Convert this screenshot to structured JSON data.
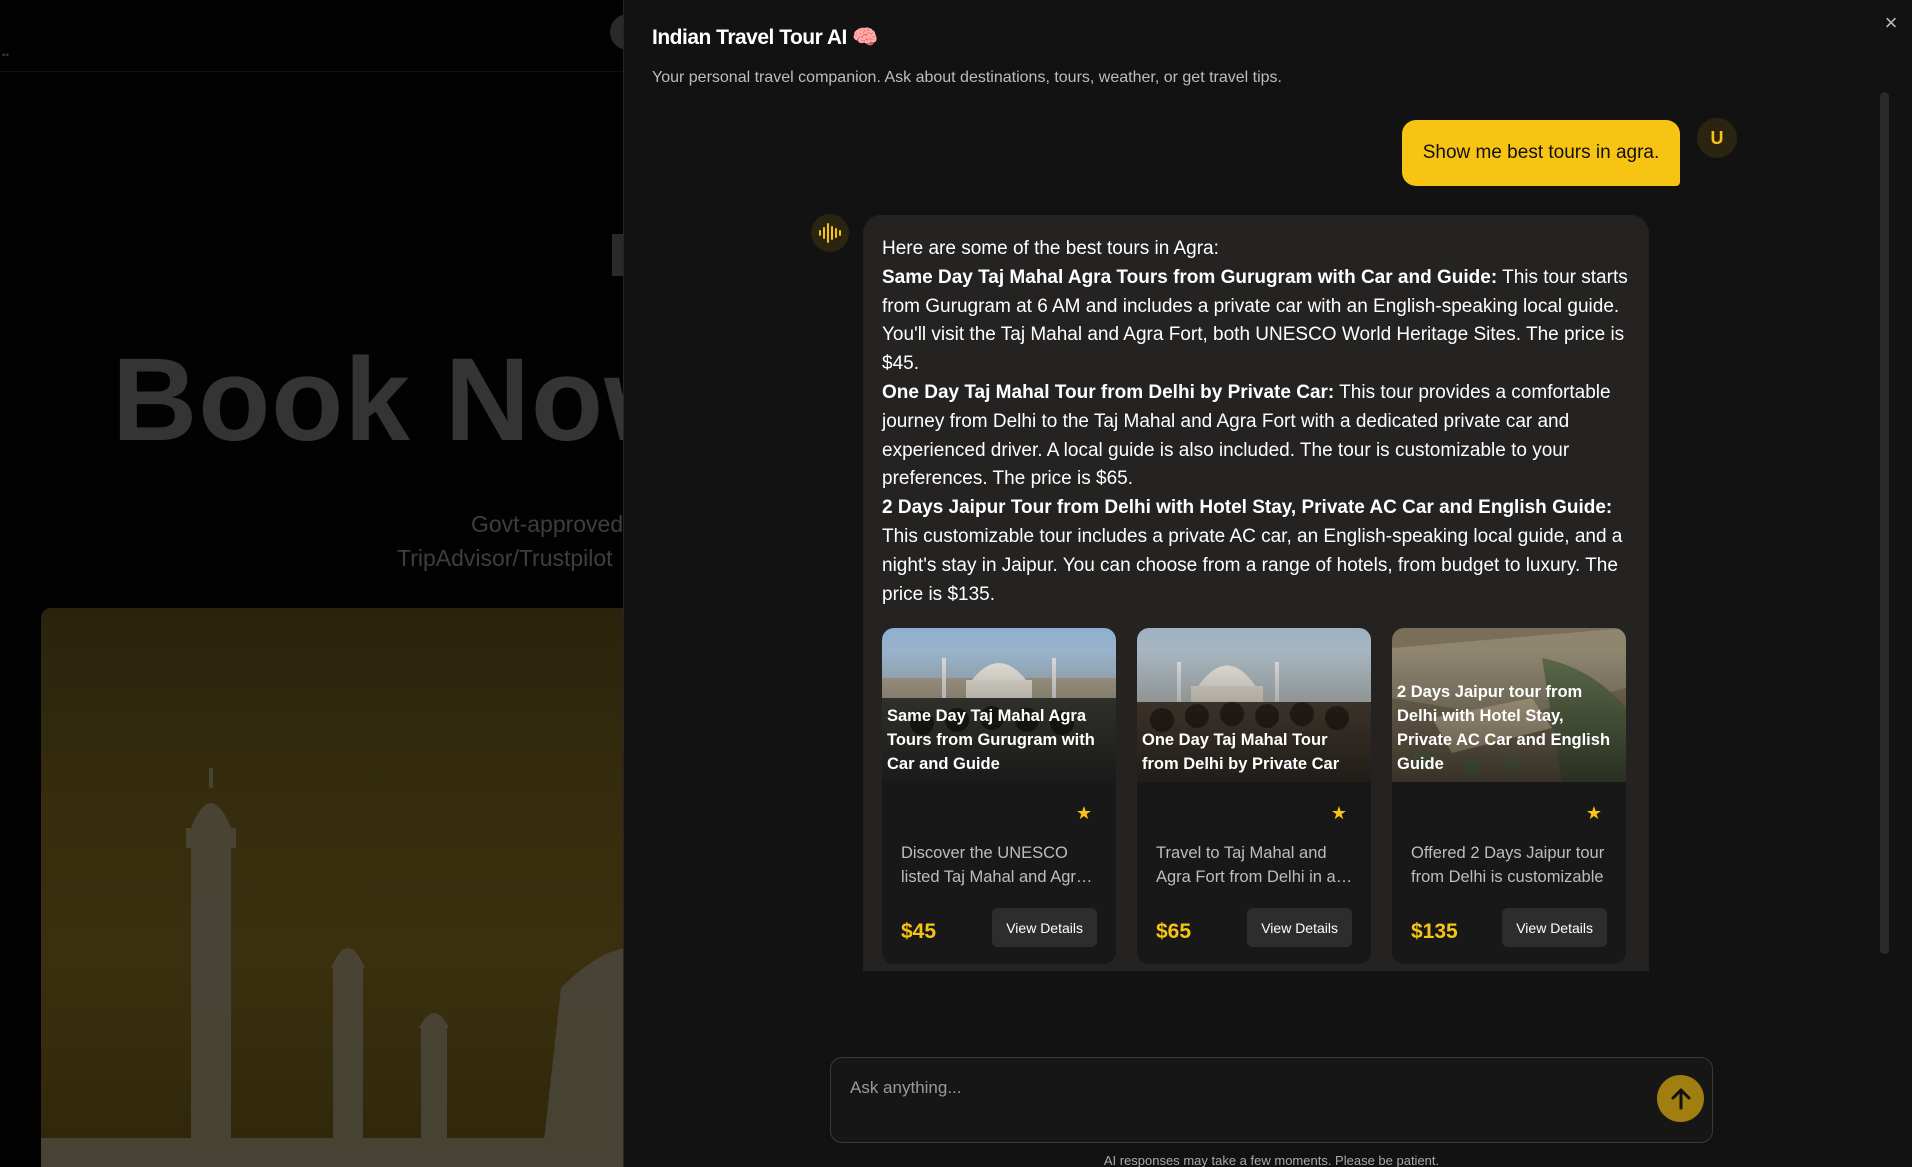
{
  "background": {
    "hero_text": "Book Now",
    "sub_line1": "Govt-approved",
    "sub_line2": "TripAdvisor/Trustpilot"
  },
  "panel": {
    "title": "Indian Travel Tour AI 🧠",
    "subtitle": "Your personal travel companion. Ask about destinations, tours, weather, or get travel tips.",
    "close_label": "×"
  },
  "user": {
    "avatar_letter": "U",
    "message": "Show me best tours in agra."
  },
  "assistant": {
    "intro": "Here are some of the best tours in Agra:",
    "items": [
      {
        "heading": "Same Day Taj Mahal Agra Tours from Gurugram with Car and Guide:",
        "body": " This tour starts from Gurugram at 6 AM and includes a private car with an English-speaking local guide. You'll visit the Taj Mahal and Agra Fort, both UNESCO World Heritage Sites. The price is $45."
      },
      {
        "heading": "One Day Taj Mahal Tour from Delhi by Private Car:",
        "body": " This tour provides a comfortable journey from Delhi to the Taj Mahal and Agra Fort with a dedicated private car and experienced driver. A local guide is also included. The tour is customizable to your preferences. The price is $65."
      },
      {
        "heading": "2 Days Jaipur Tour from Delhi with Hotel Stay, Private AC Car and English Guide:",
        "body": " This customizable tour includes a private AC car, an English-speaking local guide, and a night's stay in Jaipur. You can choose from a range of hotels, from budget to luxury. The price is $135."
      }
    ],
    "cards": [
      {
        "title": "Same Day Taj Mahal Agra Tours from Gurugram with Car and Guide",
        "star": "★",
        "description": "Discover the UNESCO listed Taj Mahal and Agra Fort",
        "price": "$45",
        "button": "View Details"
      },
      {
        "title": "One Day Taj Mahal Tour from Delhi by Private Car",
        "star": "★",
        "description": "Travel to Taj Mahal and Agra Fort from Delhi in a private car",
        "price": "$65",
        "button": "View Details"
      },
      {
        "title": "2 Days Jaipur tour from Delhi with Hotel Stay, Private AC Car and English Guide",
        "star": "★",
        "description": "Offered 2 Days Jaipur tour from Delhi is customizable",
        "price": "$135",
        "button": "View Details"
      }
    ]
  },
  "composer": {
    "placeholder": "Ask anything...",
    "disclaimer": "AI responses may take a few moments. Please be patient."
  },
  "colors": {
    "accent": "#f7c414",
    "panel_bg": "#121212",
    "bubble_bg": "#252322"
  }
}
